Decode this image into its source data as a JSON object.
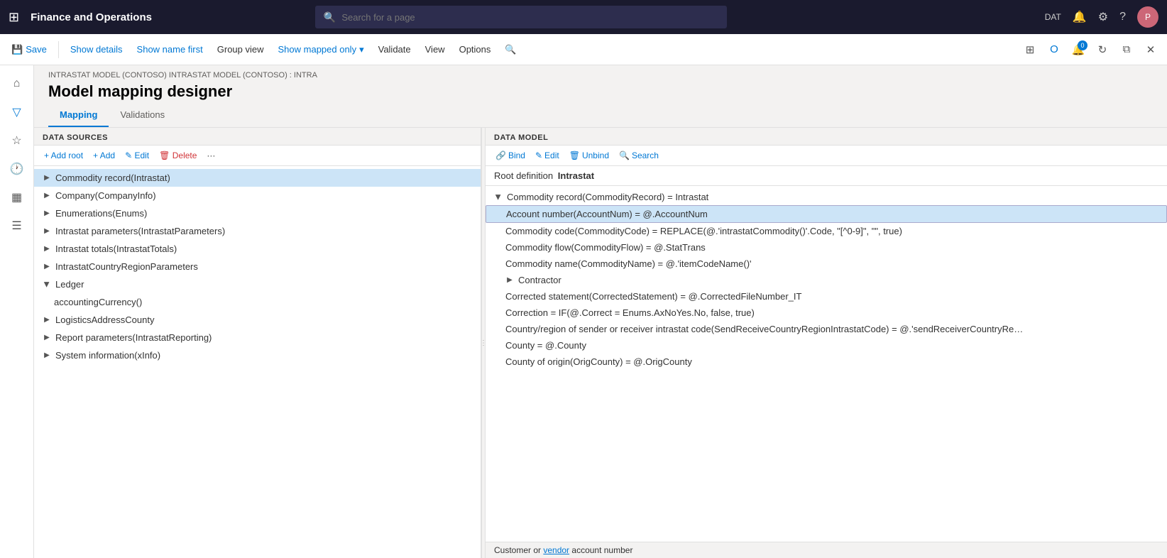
{
  "topNav": {
    "appTitle": "Finance and Operations",
    "searchPlaceholder": "Search for a page",
    "envBadge": "DAT",
    "notifIcon": "🔔",
    "settingsIcon": "⚙",
    "helpIcon": "?",
    "avatarInitial": "P"
  },
  "toolbar": {
    "saveLabel": "Save",
    "showDetailsLabel": "Show details",
    "showNameFirstLabel": "Show name first",
    "groupViewLabel": "Group view",
    "showMappedOnlyLabel": "Show mapped only",
    "validateLabel": "Validate",
    "viewLabel": "View",
    "optionsLabel": "Options",
    "searchIcon": "🔍"
  },
  "breadcrumb": "INTRASTAT MODEL (CONTOSO) INTRASTAT MODEL (CONTOSO) : INTRA",
  "pageTitle": "Model mapping designer",
  "tabs": [
    {
      "label": "Mapping",
      "active": true
    },
    {
      "label": "Validations",
      "active": false
    }
  ],
  "leftPanel": {
    "header": "DATA SOURCES",
    "addRootLabel": "+ Add root",
    "addLabel": "+ Add",
    "editLabel": "✎ Edit",
    "deleteLabel": "🗑 Delete",
    "moreLabel": "···",
    "items": [
      {
        "label": "Commodity record(Intrastat)",
        "expanded": false,
        "selected": true,
        "level": 0
      },
      {
        "label": "Company(CompanyInfo)",
        "expanded": false,
        "selected": false,
        "level": 0
      },
      {
        "label": "Enumerations(Enums)",
        "expanded": false,
        "selected": false,
        "level": 0
      },
      {
        "label": "Intrastat parameters(IntrastatParameters)",
        "expanded": false,
        "selected": false,
        "level": 0
      },
      {
        "label": "Intrastat totals(IntrastatTotals)",
        "expanded": false,
        "selected": false,
        "level": 0
      },
      {
        "label": "IntrastatCountryRegionParameters",
        "expanded": false,
        "selected": false,
        "level": 0
      },
      {
        "label": "Ledger",
        "expanded": true,
        "selected": false,
        "level": 0
      },
      {
        "label": "accountingCurrency()",
        "expanded": false,
        "selected": false,
        "level": 1
      },
      {
        "label": "LogisticsAddressCounty",
        "expanded": false,
        "selected": false,
        "level": 0
      },
      {
        "label": "Report parameters(IntrastatReporting)",
        "expanded": false,
        "selected": false,
        "level": 0
      },
      {
        "label": "System information(xInfo)",
        "expanded": false,
        "selected": false,
        "level": 0
      }
    ]
  },
  "rightPanel": {
    "header": "DATA MODEL",
    "bindLabel": "Bind",
    "editLabel": "Edit",
    "unbindLabel": "Unbind",
    "searchLabel": "Search",
    "rootDefinitionLabel": "Root definition",
    "rootDefinitionValue": "Intrastat",
    "items": [
      {
        "label": "Commodity record(CommodityRecord) = Intrastat",
        "level": 0,
        "expanded": true,
        "selected": false
      },
      {
        "label": "Account number(AccountNum) = @.AccountNum",
        "level": 1,
        "expanded": false,
        "selected": true
      },
      {
        "label": "Commodity code(CommodityCode) = REPLACE(@.'intrastatCommodity()'.Code, \"[^0-9]\", \"\", true)",
        "level": 1,
        "expanded": false,
        "selected": false
      },
      {
        "label": "Commodity flow(CommodityFlow) = @.StatTrans",
        "level": 1,
        "expanded": false,
        "selected": false
      },
      {
        "label": "Commodity name(CommodityName) = @.'itemCodeName()'",
        "level": 1,
        "expanded": false,
        "selected": false
      },
      {
        "label": "Contractor",
        "level": 1,
        "expanded": false,
        "selected": false
      },
      {
        "label": "Corrected statement(CorrectedStatement) = @.CorrectedFileNumber_IT",
        "level": 1,
        "expanded": false,
        "selected": false
      },
      {
        "label": "Correction = IF(@.Correct = Enums.AxNoYes.No, false, true)",
        "level": 1,
        "expanded": false,
        "selected": false
      },
      {
        "label": "Country/region of sender or receiver intrastat code(SendReceiveCountryRegionIntrastatCode) = @.'sendReceiverCountryRe…",
        "level": 1,
        "expanded": false,
        "selected": false
      },
      {
        "label": "County = @.County",
        "level": 1,
        "expanded": false,
        "selected": false
      },
      {
        "label": "County of origin(OrigCounty) = @.OrigCounty",
        "level": 1,
        "expanded": false,
        "selected": false
      }
    ]
  },
  "bottomBar": {
    "text": "Customer or vendor account number"
  }
}
